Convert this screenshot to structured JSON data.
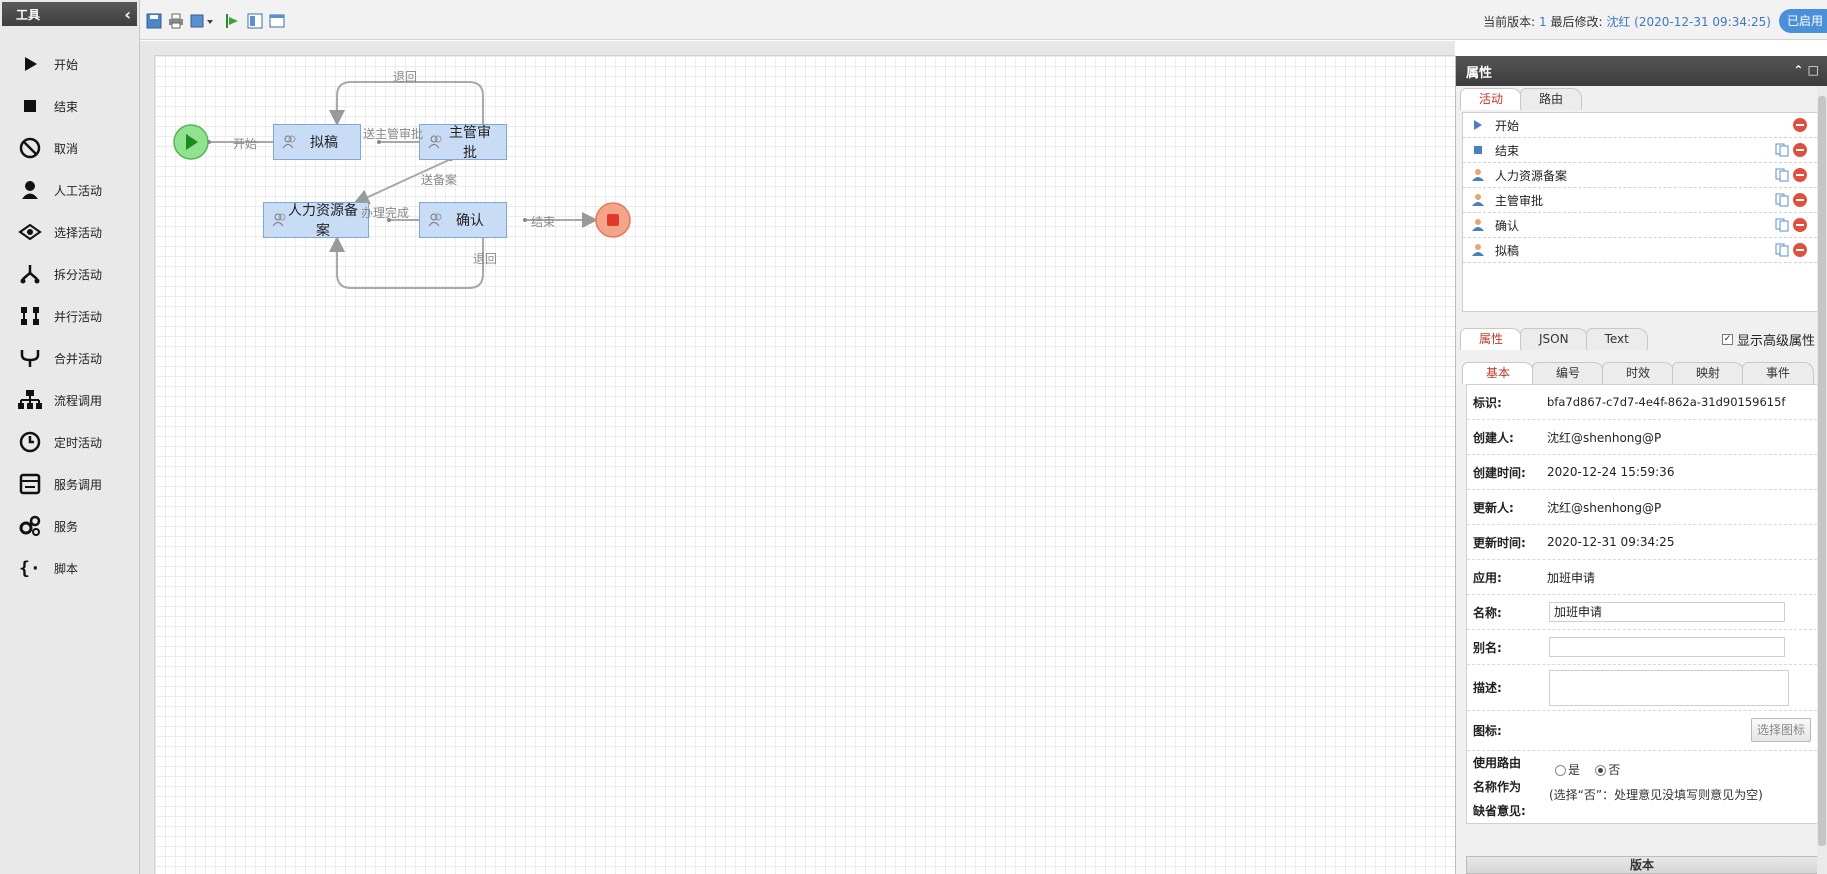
{
  "toolbox": {
    "title": "工具",
    "items": [
      {
        "label": "开始",
        "icon": "play-icon"
      },
      {
        "label": "结束",
        "icon": "stop-square-icon"
      },
      {
        "label": "取消",
        "icon": "cancel-circle-icon"
      },
      {
        "label": "人工活动",
        "icon": "user-icon"
      },
      {
        "label": "选择活动",
        "icon": "choice-eye-icon"
      },
      {
        "label": "拆分活动",
        "icon": "split-icon"
      },
      {
        "label": "并行活动",
        "icon": "parallel-icon"
      },
      {
        "label": "合并活动",
        "icon": "merge-icon"
      },
      {
        "label": "流程调用",
        "icon": "subprocess-icon"
      },
      {
        "label": "定时活动",
        "icon": "clock-icon"
      },
      {
        "label": "服务调用",
        "icon": "service-call-icon"
      },
      {
        "label": "服务",
        "icon": "gears-icon"
      },
      {
        "label": "脚本",
        "icon": "script-braces-icon"
      }
    ]
  },
  "topbar": {
    "version_label": "当前版本: ",
    "version_num": "1",
    "last_modified_label": " 最后修改: ",
    "last_modified_value": "沈红 (2020-12-31 09:34:25)",
    "enabled_button": "已启用"
  },
  "flow": {
    "nodes": {
      "draft": "拟稿",
      "manager_approve": "主管审批",
      "hr_record": "人力资源备案",
      "confirm": "确认"
    },
    "edges": {
      "start": "开始",
      "back_top": "退回",
      "send_manager": "送主管审批",
      "send_record": "送备案",
      "done": "办理完成",
      "end": "结束",
      "back_bottom": "退回"
    }
  },
  "properties": {
    "title": "属性",
    "tabs": [
      "活动",
      "路由"
    ],
    "activities": [
      {
        "label": "开始",
        "icon": "start-triangle-icon"
      },
      {
        "label": "结束",
        "icon": "end-square-icon"
      },
      {
        "label": "人力资源备案",
        "icon": "user-icon"
      },
      {
        "label": "主管审批",
        "icon": "user-icon"
      },
      {
        "label": "确认",
        "icon": "user-icon"
      },
      {
        "label": "拟稿",
        "icon": "user-icon"
      }
    ],
    "attr_tabs": [
      "属性",
      "JSON",
      "Text"
    ],
    "show_advanced": "显示高级属性",
    "sub_tabs": [
      "基本",
      "编号",
      "时效",
      "映射",
      "事件"
    ],
    "fields": {
      "id_label": "标识:",
      "id_value": "bfa7d867-c7d7-4e4f-862a-31d90159615f",
      "creator_label": "创建人:",
      "creator_value": "沈红@shenhong@P",
      "created_label": "创建时间:",
      "created_value": "2020-12-24 15:59:36",
      "updater_label": "更新人:",
      "updater_value": "沈红@shenhong@P",
      "updated_label": "更新时间:",
      "updated_value": "2020-12-31 09:34:25",
      "app_label": "应用:",
      "app_value": "加班申请",
      "name_label": "名称:",
      "name_value": "加班申请",
      "alias_label": "别名:",
      "alias_value": "",
      "desc_label": "描述:",
      "icon_label": "图标:",
      "choose_icon": "选择图标",
      "route_label_1": "使用路由",
      "route_label_2": "名称作为",
      "route_label_3": "缺省意见:",
      "yes": "是",
      "no": "否",
      "route_hint": "(选择“否”：处理意见没填写则意见为空)"
    },
    "version_bar": "版本"
  },
  "colors": {
    "node_fill": "#c9dcf6",
    "node_border": "#7fa6d6",
    "start_green": "#6fd66f",
    "end_red": "#f08060",
    "enabled_blue": "#4a90d9",
    "delete_red": "#e0503f"
  }
}
